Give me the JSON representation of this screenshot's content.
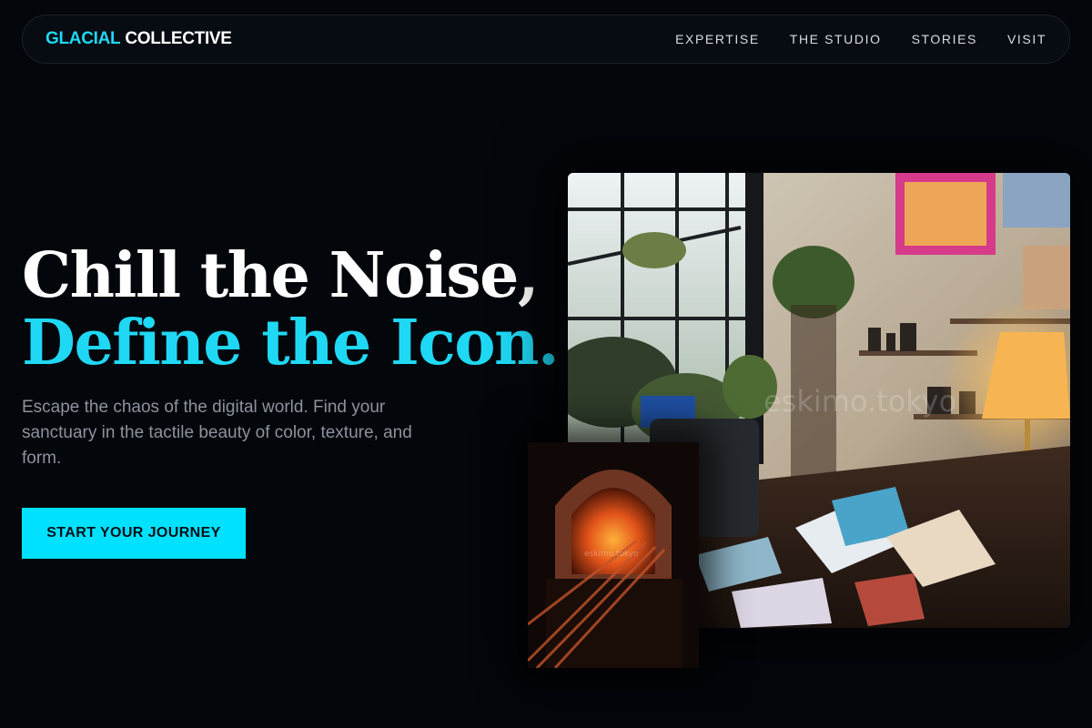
{
  "brand": {
    "accent": "GLACIAL",
    "name": "COLLECTIVE"
  },
  "nav": {
    "items": [
      {
        "label": "EXPERTISE"
      },
      {
        "label": "THE STUDIO"
      },
      {
        "label": "STORIES"
      },
      {
        "label": "VISIT"
      }
    ]
  },
  "hero": {
    "title_line1": "Chill the Noise,",
    "title_line2": "Define the Icon.",
    "subtitle": "Escape the chaos of the digital world. Find your sanctuary in the tactile beauty of color, texture, and form.",
    "cta_label": "START YOUR JOURNEY"
  },
  "images": {
    "main": {
      "description": "Artist studio with window, plants, lamp and sketchbooks",
      "watermark": "eskimo.tokyo"
    },
    "secondary": {
      "description": "Glowing kiln with metal rods",
      "watermark": "eskimo.tokyo"
    }
  },
  "colors": {
    "background": "#03060b",
    "accent": "#1fd8f4",
    "cta": "#00e1ff",
    "subtitle": "#8c939c"
  }
}
